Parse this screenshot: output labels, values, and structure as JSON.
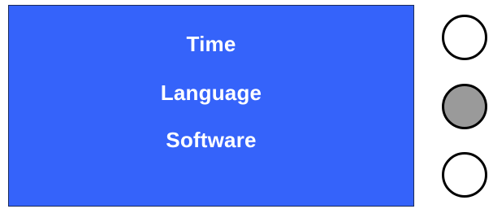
{
  "menu": {
    "items": [
      {
        "label": "Time"
      },
      {
        "label": "Language"
      },
      {
        "label": "Software"
      }
    ]
  },
  "buttons": [
    {
      "name": "button-1",
      "state": "off"
    },
    {
      "name": "button-2",
      "state": "selected"
    },
    {
      "name": "button-3",
      "state": "off"
    }
  ],
  "colors": {
    "screen_background": "#3563fa",
    "menu_text": "#ffffff",
    "button_fill": "#ffffff",
    "button_selected_fill": "#9a9a9a",
    "button_border": "#000000"
  }
}
